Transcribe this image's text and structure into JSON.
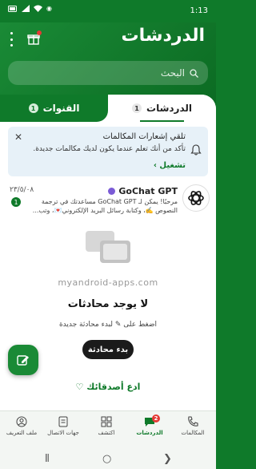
{
  "status": {
    "time": "1:13"
  },
  "header": {
    "title": "الدردشات"
  },
  "search": {
    "placeholder": "البحث"
  },
  "tabs": [
    {
      "label": "الدردشات",
      "badge": "1"
    },
    {
      "label": "القنوات",
      "badge": "1"
    }
  ],
  "notification": {
    "title": "تلقي إشعارات المكالمات",
    "description": "تأكد من أنك تعلم عندما يكون لديك مكالمات جديدة.",
    "action": "تشغيل ›"
  },
  "chat": {
    "name": "GoChat GPT",
    "date": "٢٣/٥/٠٨",
    "message": "مرحبًا! يمكن لـ GoChat GPT مساعدتك في ترجمة النصوص ✍️، وكتابة رسائل البريد الإلكتروني💌، وتب...",
    "unread": "1"
  },
  "empty": {
    "watermark": "myandroid-apps.com",
    "title": "لا يوجد محادثات",
    "hint": "اضغط على ✎ لبدء محادثة جديدة",
    "button": "بدء محادثة",
    "invite": "ادع أصدقائك"
  },
  "nav": [
    {
      "label": "المكالمات"
    },
    {
      "label": "الدردشات",
      "badge": "2"
    },
    {
      "label": "اكتشف"
    },
    {
      "label": "جهات الاتصال"
    },
    {
      "label": "ملف التعريف"
    }
  ],
  "colors": {
    "brand": "#0f7a2a",
    "accent_red": "#e53935",
    "verified": "#7b5bd6"
  }
}
